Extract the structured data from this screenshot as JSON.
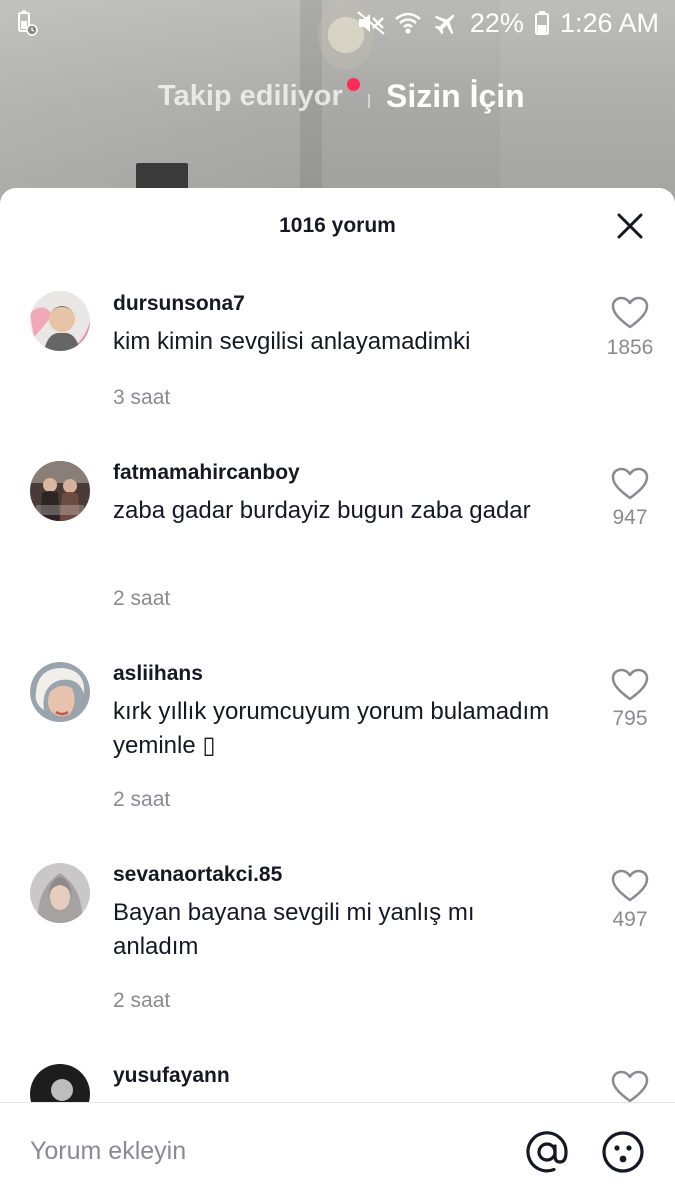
{
  "status_bar": {
    "battery_percent": "22%",
    "time": "1:26 AM",
    "icons": [
      "battery-saver-icon",
      "silent-icon",
      "wifi-icon",
      "airplane-mode-icon",
      "battery-icon"
    ]
  },
  "top_tabs": {
    "following": "Takip ediliyor",
    "for_you": "Sizin İçin",
    "notification_dot_color": "#fe2c55"
  },
  "comments_sheet": {
    "count_label": "1016 yorum",
    "close_icon": "close-icon",
    "comments": [
      {
        "username": "dursunsona7",
        "text": "kim kimin sevgilisi anlayamadimki",
        "time": "3 saat",
        "likes": "1856"
      },
      {
        "username": "fatmamahircanboy",
        "text": "zaba gadar burdayiz bugun zaba gadar",
        "time": "2 saat",
        "likes": "947"
      },
      {
        "username": "asliihans",
        "text": "kırk yıllık yorumcuyum yorum bulamadım yeminle ▯",
        "time": "2 saat",
        "likes": "795"
      },
      {
        "username": "sevanaortakci.85",
        "text": "Bayan bayana sevgili mi yanlış mı anladım",
        "time": "2 saat",
        "likes": "497"
      },
      {
        "username": "yusufayann",
        "text": "",
        "time": "",
        "likes": ""
      }
    ]
  },
  "input_bar": {
    "placeholder": "Yorum ekleyin",
    "value": "",
    "mention_icon": "at-icon",
    "emoji_icon": "emoji-icon"
  },
  "colors": {
    "accent": "#fe2c55",
    "text_primary": "#161823",
    "text_secondary": "#8a8b91"
  }
}
